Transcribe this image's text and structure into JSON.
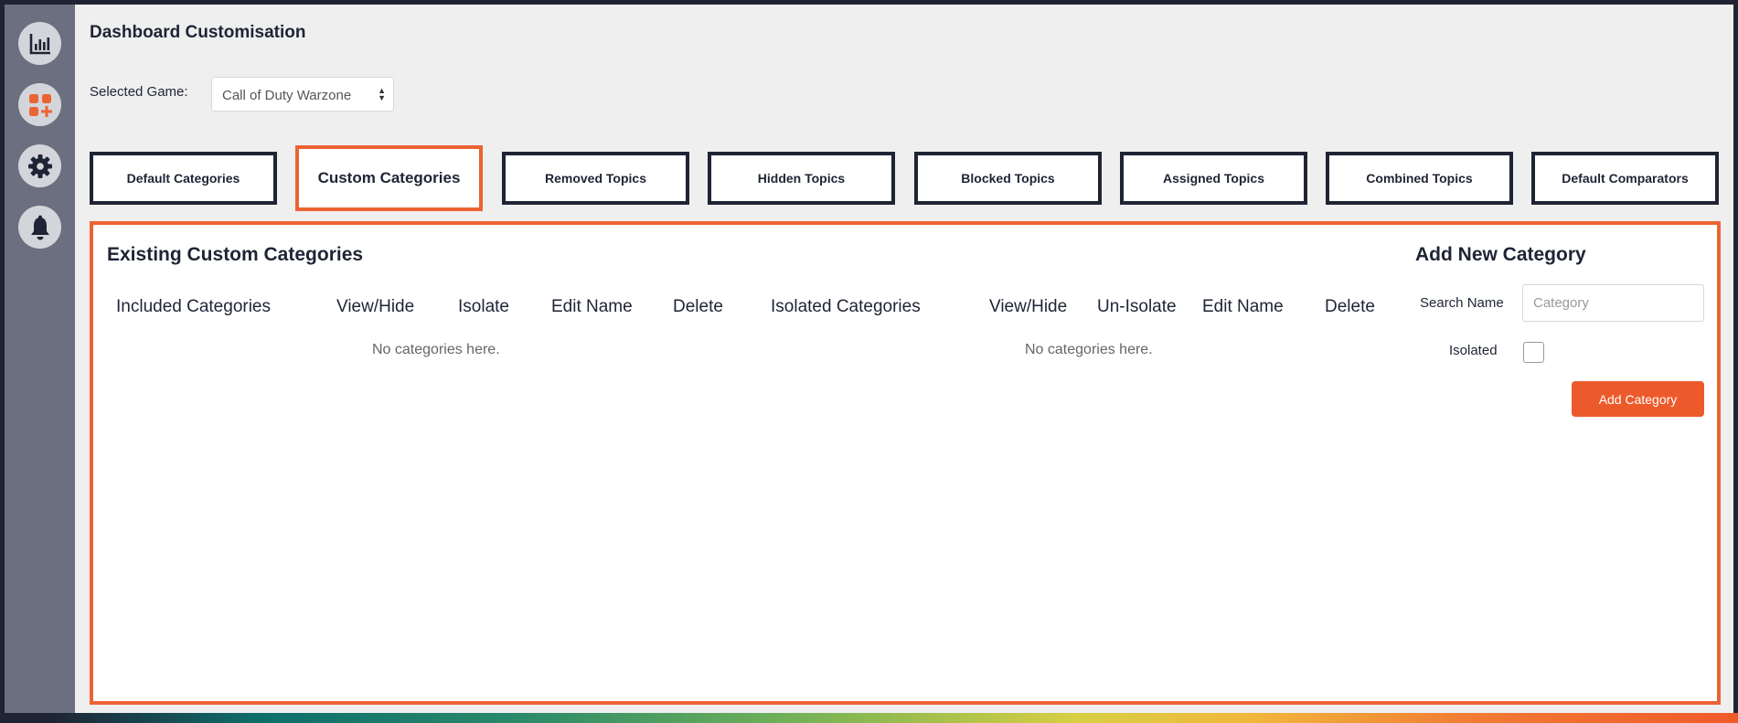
{
  "page": {
    "title": "Dashboard Customisation"
  },
  "sidebar": {
    "items": [
      {
        "name": "analytics-icon"
      },
      {
        "name": "add-category-icon"
      },
      {
        "name": "gear-icon"
      },
      {
        "name": "bell-icon"
      }
    ]
  },
  "game": {
    "label": "Selected Game:",
    "selected": "Call of Duty Warzone"
  },
  "tabs": [
    {
      "label": "Default Categories",
      "active": false
    },
    {
      "label": "Custom Categories",
      "active": true
    },
    {
      "label": "Removed Topics",
      "active": false
    },
    {
      "label": "Hidden Topics",
      "active": false
    },
    {
      "label": "Blocked Topics",
      "active": false
    },
    {
      "label": "Assigned Topics",
      "active": false
    },
    {
      "label": "Combined Topics",
      "active": false
    },
    {
      "label": "Default Comparators",
      "active": false
    }
  ],
  "existing": {
    "title": "Existing Custom Categories",
    "included": {
      "headers": [
        "Included Categories",
        "View/Hide",
        "Isolate",
        "Edit Name",
        "Delete"
      ],
      "empty": "No categories here."
    },
    "isolated": {
      "headers": [
        "Isolated Categories",
        "View/Hide",
        "Un-Isolate",
        "Edit Name",
        "Delete"
      ],
      "empty": "No categories here."
    }
  },
  "add_new": {
    "title": "Add New Category",
    "search_label": "Search Name",
    "search_placeholder": "Category",
    "search_value": "",
    "isolated_label": "Isolated",
    "isolated_checked": false,
    "button_label": "Add Category"
  },
  "colors": {
    "accent": "#ec6333",
    "navy": "#1f2435",
    "sidebar": "#6b6f80"
  }
}
